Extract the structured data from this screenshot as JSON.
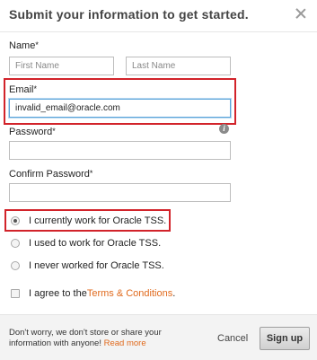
{
  "dialog": {
    "title": "Submit your information to get started."
  },
  "form": {
    "name_label": "Name",
    "first_name_placeholder": "First Name",
    "last_name_placeholder": "Last Name",
    "email_label": "Email",
    "email_value": "invalid_email@oracle.com",
    "password_label": "Password",
    "confirm_password_label": "Confirm Password",
    "required_marker": "*",
    "info_glyph": "i",
    "radio_options": [
      {
        "label": "I currently work for Oracle TSS.",
        "checked": true
      },
      {
        "label": "I used to work for Oracle TSS.",
        "checked": false
      },
      {
        "label": "I never worked for Oracle TSS.",
        "checked": false
      }
    ],
    "agree_prefix": "I agree to the",
    "agree_link": "Terms & Conditions",
    "agree_suffix": "."
  },
  "footer": {
    "notice": "Don't worry, we don't store or share your information with anyone!",
    "read_more": "Read more",
    "cancel_label": "Cancel",
    "signup_label": "Sign up"
  },
  "colors": {
    "highlight": "#d2232a",
    "link": "#e06a1d",
    "focus_border": "#5aa3d8"
  }
}
